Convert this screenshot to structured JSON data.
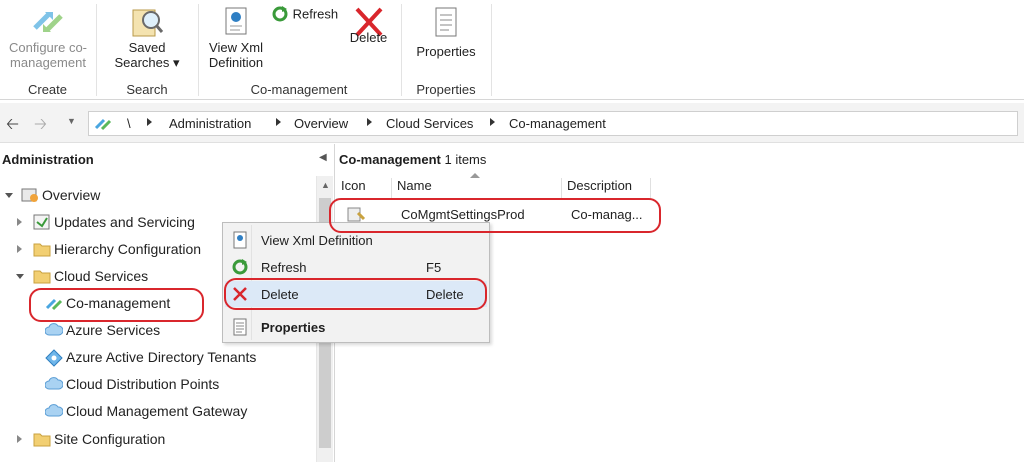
{
  "ribbon": {
    "groups": [
      {
        "label": "Create",
        "buttons": [
          {
            "label": "Configure co-management"
          }
        ]
      },
      {
        "label": "Search",
        "buttons": [
          {
            "label": "Saved Searches"
          }
        ]
      },
      {
        "label": "Co-management",
        "buttons": [
          {
            "label": "View Xml Definition"
          },
          {
            "label": "Refresh"
          },
          {
            "label": "Delete"
          }
        ]
      },
      {
        "label": "Properties",
        "buttons": [
          {
            "label": "Properties"
          }
        ]
      }
    ],
    "configure_line1": "Configure co-",
    "configure_line2": "management",
    "saved_line1": "Saved",
    "saved_line2": "Searches ▾",
    "viewxml_line1": "View Xml",
    "viewxml_line2": "Definition"
  },
  "address_bar": {
    "breadcrumbs": [
      "\\",
      "Administration",
      "Overview",
      "Cloud Services",
      "Co-management"
    ]
  },
  "left_pane": {
    "title": "Administration",
    "tree": [
      {
        "label": "Overview",
        "icon": "overview-icon",
        "expanded": true
      },
      {
        "label": "Updates and Servicing",
        "icon": "updates-icon"
      },
      {
        "label": "Hierarchy Configuration",
        "icon": "folder-icon"
      },
      {
        "label": "Cloud Services",
        "icon": "folder-icon",
        "expanded": true
      },
      {
        "label": "Co-management",
        "icon": "co-management-icon",
        "selected": true
      },
      {
        "label": "Azure Services",
        "icon": "cloud-icon"
      },
      {
        "label": "Azure Active Directory Tenants",
        "icon": "aad-icon"
      },
      {
        "label": "Cloud Distribution Points",
        "icon": "cloud-icon"
      },
      {
        "label": "Cloud Management Gateway",
        "icon": "cloud-icon"
      },
      {
        "label": "Site Configuration",
        "icon": "folder-icon"
      }
    ]
  },
  "right_pane": {
    "title": "Co-management",
    "count": "1 items",
    "columns": [
      "Icon",
      "Name",
      "Description"
    ],
    "rows": [
      {
        "name": "CoMgmtSettingsProd",
        "description": "Co-manag..."
      }
    ]
  },
  "context_menu": {
    "items": [
      {
        "label": "View Xml Definition",
        "shortcut": ""
      },
      {
        "label": "Refresh",
        "shortcut": "F5"
      },
      {
        "label": "Delete",
        "shortcut": "Delete"
      },
      {
        "label": "Properties",
        "shortcut": ""
      }
    ]
  },
  "colors": {
    "highlight_ring": "#d9262c",
    "menu_hover": "#dce9f7",
    "folder": "#e8c15a",
    "cloud": "#7fb6e6"
  }
}
